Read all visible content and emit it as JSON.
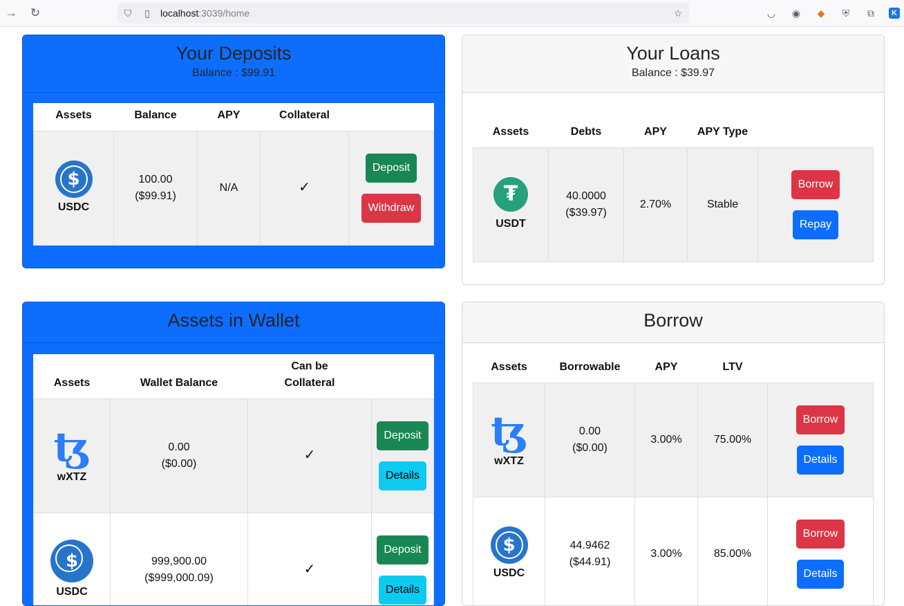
{
  "browser": {
    "url_host": "localhost",
    "url_rest": ":3039/home"
  },
  "deposits": {
    "title": "Your Deposits",
    "balance": "Balance : $99.91",
    "headers": [
      "Assets",
      "Balance",
      "APY",
      "Collateral"
    ],
    "rows": [
      {
        "asset": "USDC",
        "icon": "usdc-icon",
        "balance": "100.00",
        "balance_usd": "($99.91)",
        "apy": "N/A",
        "collateral": "✓",
        "btn1": "Deposit",
        "btn2": "Withdraw"
      }
    ]
  },
  "loans": {
    "title": "Your Loans",
    "balance": "Balance : $39.97",
    "headers": [
      "Assets",
      "Debts",
      "APY",
      "APY Type"
    ],
    "rows": [
      {
        "asset": "USDT",
        "icon": "usdt-icon",
        "debt": "40.0000",
        "debt_usd": "($39.97)",
        "apy": "2.70%",
        "type": "Stable",
        "btn1": "Borrow",
        "btn2": "Repay"
      }
    ]
  },
  "wallet": {
    "title": "Assets in Wallet",
    "headers": [
      "Assets",
      "Wallet Balance",
      "Can be Collateral"
    ],
    "rows": [
      {
        "asset": "wXTZ",
        "icon": "tezos-icon",
        "balance": "0.00",
        "balance_usd": "($0.00)",
        "collateral": "✓",
        "btn1": "Deposit",
        "btn2": "Details"
      },
      {
        "asset": "USDC",
        "icon": "usdc-icon",
        "balance": "999,900.00",
        "balance_usd": "($999,000.09)",
        "collateral": "✓",
        "btn1": "Deposit",
        "btn2": "Details"
      }
    ]
  },
  "borrow": {
    "title": "Borrow",
    "headers": [
      "Assets",
      "Borrowable",
      "APY",
      "LTV"
    ],
    "rows": [
      {
        "asset": "wXTZ",
        "icon": "tezos-icon",
        "amount": "0.00",
        "amount_usd": "($0.00)",
        "apy": "3.00%",
        "ltv": "75.00%",
        "btn1": "Borrow",
        "btn2": "Details"
      },
      {
        "asset": "USDC",
        "icon": "usdc-icon",
        "amount": "44.9462",
        "amount_usd": "($44.91)",
        "apy": "3.00%",
        "ltv": "85.00%",
        "btn1": "Borrow",
        "btn2": "Details"
      }
    ]
  }
}
